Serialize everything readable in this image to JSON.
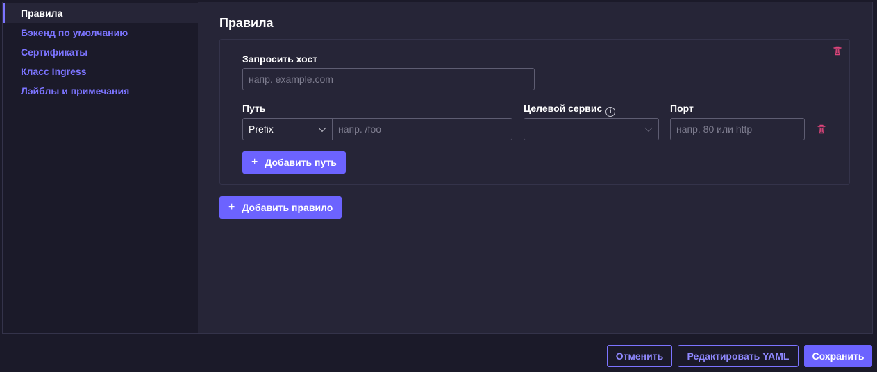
{
  "sidebar": {
    "items": [
      {
        "label": "Правила",
        "active": true
      },
      {
        "label": "Бэкенд по умолчанию"
      },
      {
        "label": "Сертификаты"
      },
      {
        "label": "Класс Ingress"
      },
      {
        "label": "Лэйблы и примечания"
      }
    ]
  },
  "main": {
    "title": "Правила",
    "rule": {
      "host_label": "Запросить хост",
      "host_placeholder": "напр. example.com",
      "path_label": "Путь",
      "path_type": "Prefix",
      "path_placeholder": "напр. /foo",
      "service_label": "Целевой сервис",
      "service_value": "",
      "port_label": "Порт",
      "port_placeholder": "напр. 80 или http",
      "add_path_label": "Добавить путь"
    },
    "add_rule_label": "Добавить правило"
  },
  "footer": {
    "cancel_label": "Отменить",
    "edit_yaml_label": "Редактировать YAML",
    "save_label": "Сохранить"
  },
  "icons": {
    "trash": "trash-icon",
    "plus": "plus-icon",
    "info": "info-icon",
    "chevron": "chevron-down-icon"
  },
  "colors": {
    "accent": "#6c63ff",
    "danger": "#e0457b",
    "background": "#262537",
    "sidebar": "#1b1a29"
  }
}
